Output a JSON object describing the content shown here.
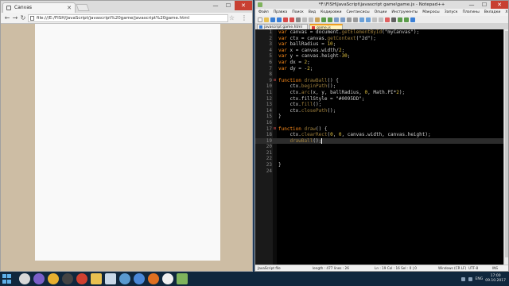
{
  "browser": {
    "tab_title": "Canvas",
    "url": "file:///E:/FISH/JavaScript/javascript%20game/javascript%20game.html",
    "win_minimize": "—",
    "win_maximize": "☐",
    "win_close": "✕"
  },
  "notepad": {
    "title": "*F:\\FISH\\JavaScript\\javascript game\\game.js - Notepad++",
    "menu": [
      "Файл",
      "Правка",
      "Поиск",
      "Вид",
      "Кодировки",
      "Синтаксисы",
      "Опции",
      "Инструменты",
      "Макросы",
      "Запуск",
      "Плагины",
      "Вкладки"
    ],
    "menu_close": "X",
    "tabs": [
      {
        "label": "javascript game.html",
        "active": false
      },
      {
        "label": "game.js",
        "active": true
      }
    ],
    "current_line": 19,
    "code_lines": [
      "var canvas = document.getElementById(\"myCanvas\");",
      "var ctx = canvas.getContext(\"2d\");",
      "var ballRadius = 10;",
      "var x = canvas.width/2;",
      "var y = canvas.height-30;",
      "var dx = 2;",
      "var dy = -2;",
      "",
      "function drawBall() {",
      "    ctx.beginPath();",
      "    ctx.arc(x, y, ballRadius, 0, Math.PI*2);",
      "    ctx.fillStyle = \"#0095DD\";",
      "    ctx.fill();",
      "    ctx.closePath();",
      "}",
      "",
      "function draw() {",
      "    ctx.clearRect(0, 0, canvas.width, canvas.height);",
      "    drawBall();",
      "",
      "",
      "",
      "}",
      ""
    ],
    "status": {
      "file_type": "JavaScript file",
      "length": "length : 477   lines : 26",
      "position": "Ln : 19   Col : 16   Sel : 0 | 0",
      "eol": "Windows (CR LF)",
      "encoding": "UTF-8",
      "mode": "INS"
    }
  },
  "taskbar": {
    "language": "ENG",
    "time": "17:00",
    "date": "09.10.2017"
  },
  "colors": {
    "keyword": "#ff8c1a",
    "page_background": "#cdbda4",
    "canvas": "#f9f9f9",
    "editor_background": "#000000"
  }
}
